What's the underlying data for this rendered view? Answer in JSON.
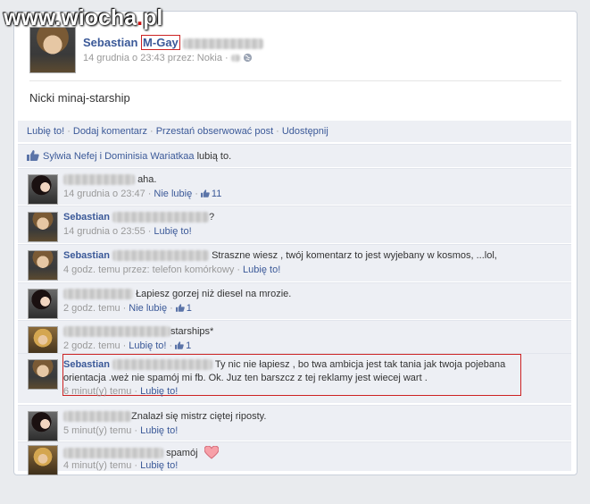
{
  "watermark": {
    "left": "www.wiocha",
    "dot": ".",
    "right": "pl"
  },
  "post": {
    "author_first": "Sebastian",
    "author_highlight": "M-Gay",
    "meta": "14 grudnia o 23:43 przez: Nokia ·",
    "text": "Nicki minaj-starship"
  },
  "actions": [
    "Lubię to!",
    "Dodaj komentarz",
    "Przestań obserwować post",
    "Udostępnij"
  ],
  "likes": {
    "names": "Sylwia Nefej i Dominisia Wariatkaa",
    "suffix": " lubią to."
  },
  "comments": [
    {
      "author": "",
      "text": "aha.",
      "meta": "14 grudnia o 23:47",
      "action": "Nie lubię",
      "likes": "11",
      "avatar": "girl"
    },
    {
      "author": "Sebastian",
      "text": "?",
      "meta": "14 grudnia o 23:55",
      "action": "Lubię to!",
      "likes": "",
      "avatar": "seb"
    },
    {
      "author": "Sebastian",
      "text": "Straszne wiesz , twój komentarz to jest wyjebany w kosmos, ...lol,",
      "meta": "4 godz. temu przez: telefon komórkowy",
      "action": "Lubię to!",
      "likes": "",
      "avatar": "seb"
    },
    {
      "author": "",
      "text": "Łapiesz gorzej niż diesel na mrozie.",
      "meta": "2 godz. temu",
      "action": "Nie lubię",
      "likes": "1",
      "avatar": "girl"
    },
    {
      "author": "",
      "text": "starships*",
      "meta": "2 godz. temu",
      "action": "Lubię to!",
      "likes": "1",
      "avatar": "blonde"
    },
    {
      "author": "Sebastian",
      "text": "Ty nic nie łapiesz , bo twa ambicja jest tak tania jak twoja pojebana orientacja .weż nie spamój mi fb. Ok. Juz ten barszcz z tej reklamy jest wiecej wart .",
      "meta": "6 minut(y) temu",
      "action": "Lubię to!",
      "likes": "",
      "avatar": "seb"
    },
    {
      "author": "",
      "text": "Znalazł się mistrz ciętej riposty.",
      "meta": "5 minut(y) temu",
      "action": "Lubię to!",
      "likes": "",
      "avatar": "girl"
    },
    {
      "author": "",
      "text": "spamój",
      "meta": "4 minut(y) temu",
      "action": "Lubię to!",
      "likes": "",
      "avatar": "blonde"
    }
  ],
  "colors": {
    "link": "#3b5998",
    "highlight": "#cc2222",
    "panel": "#edeff4"
  }
}
